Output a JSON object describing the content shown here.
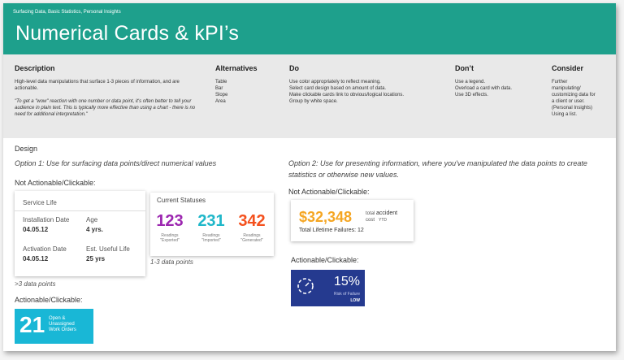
{
  "header": {
    "breadcrumb": "Surfacing Data, Basic Statistics, Personal Insights",
    "title": "Numerical Cards & kPI’s"
  },
  "guide": {
    "description": {
      "heading": "Description",
      "body": "High-level data manipulations that surface 1-3 pieces of information, and are actionable.",
      "quote": "\"To get a \"wow\" reaction with one number or data point, it's often better to tell your audience in plain text. This is typically more effective than using a chart - there is no need for additional interpretation.\""
    },
    "alternatives": {
      "heading": "Alternatives",
      "items": [
        "Table",
        "Bar",
        "Slope",
        "Area"
      ]
    },
    "do": {
      "heading": "Do",
      "items": [
        "Use color appropriately to reflect meaning.",
        "Select card design based on amount of data.",
        "Make clickable cards link to obvious/logical locations.",
        "Group by white space."
      ]
    },
    "dont": {
      "heading": "Don’t",
      "items": [
        "Use a legend.",
        "Overload a card with data.",
        "Use 3D effects."
      ]
    },
    "consider": {
      "heading": "Consider",
      "items": [
        "Further",
        "manipulating/",
        "customizing data for",
        "a client or user.",
        "(Personal Insights)",
        "Using a list."
      ]
    }
  },
  "design": {
    "heading": "Design",
    "option1": "Option 1: Use for surfacing data points/direct numerical values",
    "option2_line1": "Option 2: Use for presenting information, where you've manipulated the data points to create",
    "option2_line2": "statistics or otherwise new values.",
    "not_actionable": "Not Actionable/Clickable:",
    "actionable": "Actionable/Clickable:",
    "more_points": ">3 data points",
    "few_points": "1-3 data points"
  },
  "service_life": {
    "title": "Service Life",
    "install_label": "Installation Date",
    "install_value": "04.05.12",
    "age_label": "Age",
    "age_value": "4 yrs.",
    "activation_label": "Activation Date",
    "activation_value": "04.05.12",
    "useful_label": "Est. Useful Life",
    "useful_value": "25 yrs"
  },
  "statuses": {
    "title": "Current Statuses",
    "items": [
      {
        "value": "123",
        "cap1": "Readings",
        "cap2": "\"Exported\"",
        "color": "#9c27b0"
      },
      {
        "value": "231",
        "cap1": "Readings",
        "cap2": "\"Imported\"",
        "color": "#1fb7c9"
      },
      {
        "value": "342",
        "cap1": "Readings",
        "cap2": "\"Generated\"",
        "color": "#f4511e"
      }
    ]
  },
  "kpi": {
    "value": "$32,348",
    "total": "total",
    "accident": "accident",
    "cost": "cost",
    "ytd": "YTD",
    "failures": "Total Lifetime Failures:  12",
    "color": "#f5a623"
  },
  "work_orders": {
    "value": "21",
    "line1": "Open &",
    "line2": "Unassigned",
    "line3": "Work Orders",
    "color": "#19b7d6"
  },
  "risk": {
    "value": "15%",
    "label": "Risk of Failure",
    "level": "LOW",
    "color": "#253a8f"
  }
}
